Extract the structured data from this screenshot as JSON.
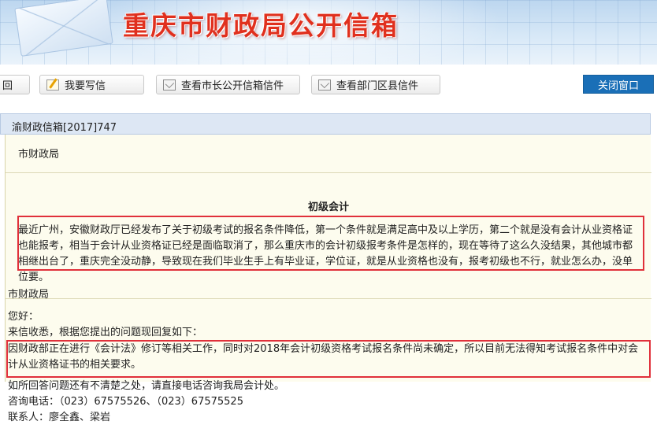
{
  "banner": {
    "title": "重庆市财政局公开信箱"
  },
  "toolbar": {
    "back_label": "回",
    "write_label": "我要写信",
    "mayor_label": "查看市长公开信箱信件",
    "dept_label": "查看部门区县信件",
    "close_label": "关闭窗口"
  },
  "letter": {
    "number": "渝财政信箱[2017]747",
    "recipient": "市财政局",
    "title": "初级会计",
    "question": "最近广州，安徽财政厅已经发布了关于初级考试的报名条件降低，第一个条件就是满足高中及以上学历，第二个就是没有会计从业资格证也能报考，相当于会计从业资格证已经是面临取消了，那么重庆市的会计初级报考条件是怎样的，现在等待了这么久没结果，其他城市都相继出台了，重庆完全没动静，导致现在我们毕业生手上有毕业证，学位证，就是从业资格也没有，报考初级也不行，就业怎么办，没单位要。"
  },
  "reply": {
    "from": "市财政局",
    "greeting": "您好：",
    "intro": "来信收悉，根据您提出的问题现回复如下：",
    "body": "因财政部正在进行《会计法》修订等相关工作，同时对2018年会计初级资格考试报名条件尚未确定，所以目前无法得知考试报名条件中对会计从业资格证书的相关要求。",
    "contact_note": "如所回答问题还有不清楚之处，请直接电话咨询我局会计处。",
    "phone": "咨询电话：（023）67575526、（023）67575525",
    "contacts": "联系人：廖全鑫、梁岩"
  }
}
